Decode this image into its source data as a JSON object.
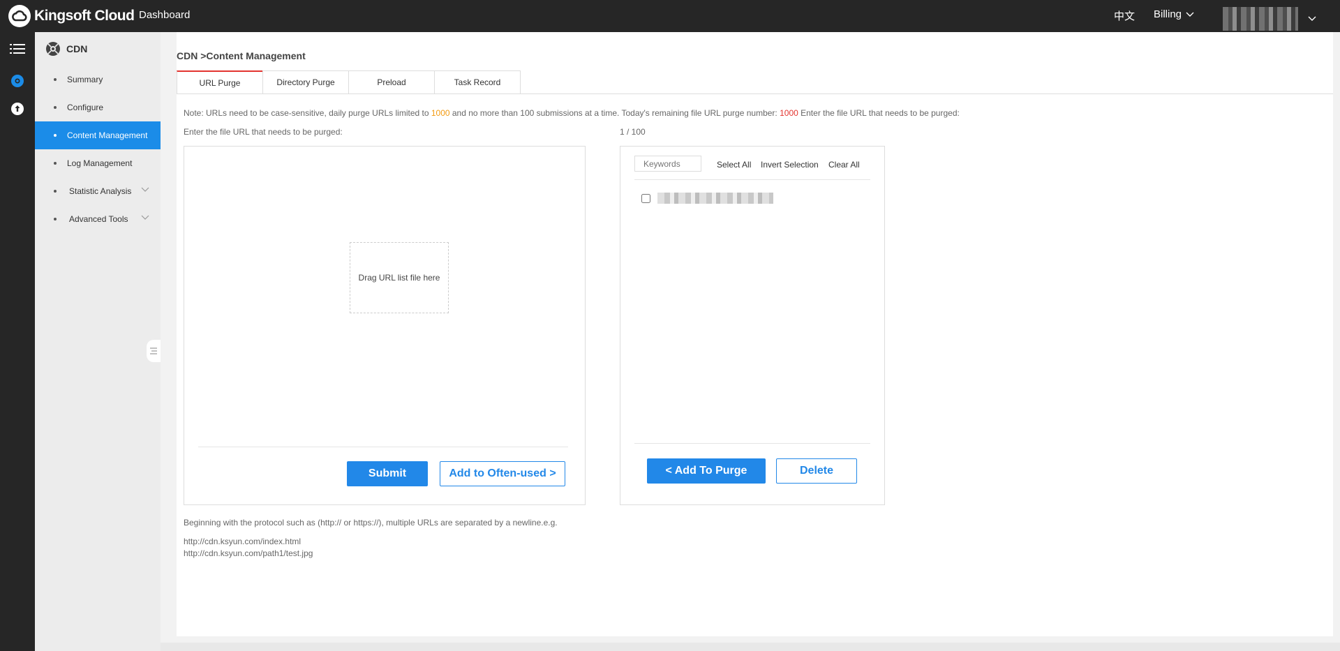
{
  "topbar": {
    "brand": "Kingsoft Cloud",
    "nav_dashboard": "Dashboard",
    "lang": "中文",
    "billing": "Billing"
  },
  "sidebar": {
    "title": "CDN",
    "items": [
      {
        "label": "Summary"
      },
      {
        "label": "Configure"
      },
      {
        "label": "Content Management",
        "active": true
      },
      {
        "label": "Log Management"
      },
      {
        "label": "Statistic Analysis",
        "expandable": true
      },
      {
        "label": "Advanced Tools",
        "expandable": true
      }
    ]
  },
  "main": {
    "breadcrumb": "CDN >Content Management",
    "tabs": [
      {
        "label": "URL Purge",
        "active": true
      },
      {
        "label": "Directory Purge"
      },
      {
        "label": "Preload"
      },
      {
        "label": "Task Record"
      }
    ],
    "note": {
      "part1": "Note: URLs need to be case-sensitive, daily purge URLs limited to ",
      "limit": "1000",
      "part2": " and no more than 100 submissions at a time. Today's remaining file URL purge number: ",
      "remaining": "1000",
      "part3": " Enter the file URL that needs to be purged:"
    },
    "left": {
      "label": "Enter the file URL that needs to be purged:",
      "dropzone": "Drag URL list file here",
      "submit": "Submit",
      "add_often": "Add to Often-used >"
    },
    "right": {
      "counter": "1 / 100",
      "keywords_placeholder": "Keywords",
      "select_all": "Select All",
      "invert_selection": "Invert Selection",
      "clear_all": "Clear All",
      "add_to_purge": "< Add To Purge",
      "delete": "Delete"
    },
    "hint": {
      "desc": "Beginning with the protocol such as (http:// or https://), multiple URLs are separated by a newline.e.g.",
      "example1": "http://cdn.ksyun.com/index.html",
      "example2": "http://cdn.ksyun.com/path1/test.jpg"
    }
  },
  "colors": {
    "topbar_bg": "#262626",
    "accent": "#2288e8",
    "active_tab": "#e3342f",
    "orange": "#f29a10"
  }
}
